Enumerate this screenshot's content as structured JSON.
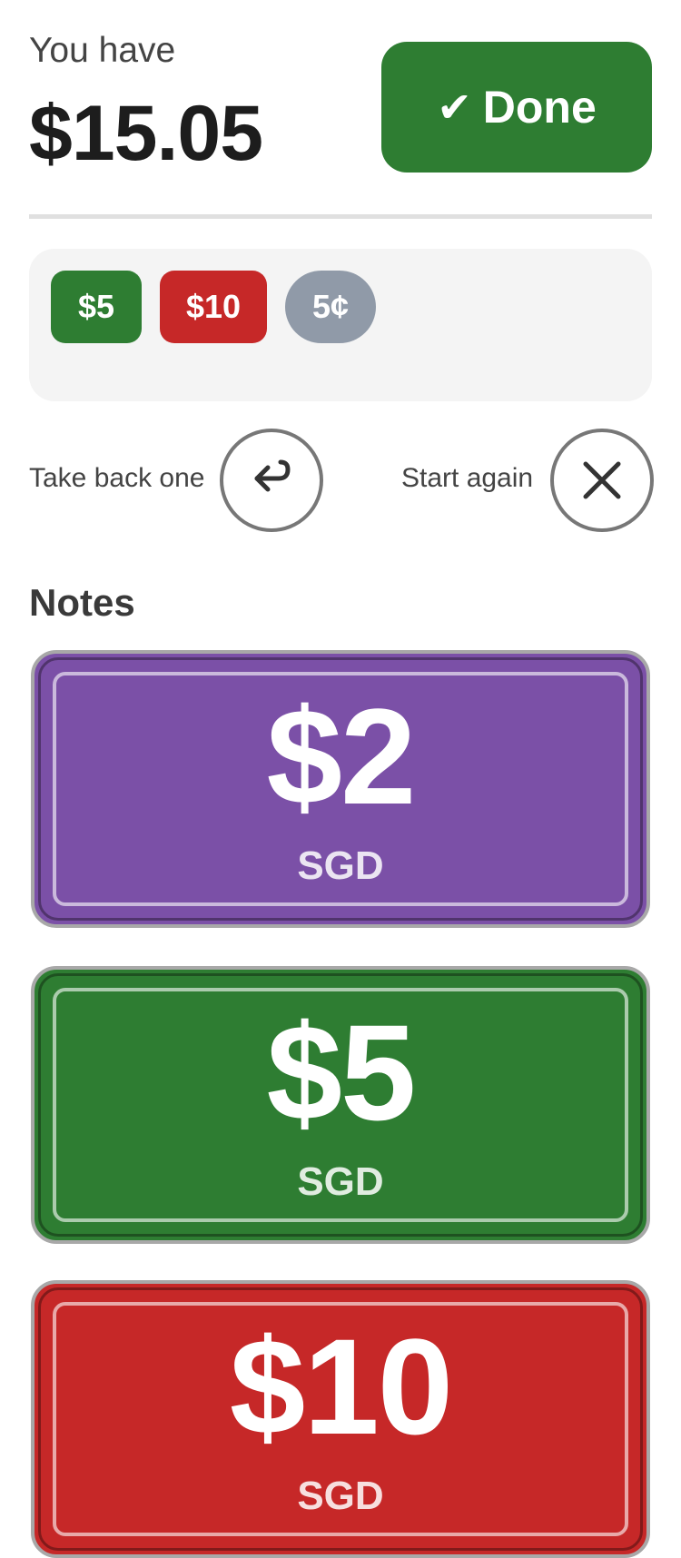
{
  "header": {
    "balance_label": "You have",
    "balance_value": "$15.05",
    "done_check": "✔",
    "done_label": "Done"
  },
  "tray": {
    "chips": [
      {
        "label": "$5",
        "color": "#2e7d32",
        "shape": "rounded-rect"
      },
      {
        "label": "$10",
        "color": "#c62828",
        "shape": "rounded-rect"
      },
      {
        "label": "5¢",
        "color": "#909aa8",
        "shape": "pill"
      }
    ]
  },
  "controls": {
    "undo_label": "Take back one",
    "undo_icon": "undo-arrow-icon",
    "reset_label": "Start again",
    "reset_icon": "close-icon"
  },
  "notes": {
    "heading": "Notes",
    "items": [
      {
        "value": "$2",
        "currency": "SGD",
        "color": "#7b50a7"
      },
      {
        "value": "$5",
        "currency": "SGD",
        "color": "#2e7d32"
      },
      {
        "value": "$10",
        "currency": "SGD",
        "color": "#c62828"
      }
    ]
  },
  "colors": {
    "done_button": "#2e7d32",
    "divider": "#e0e0e0",
    "tray_background": "#f4f4f4",
    "control_ring": "#777777"
  }
}
